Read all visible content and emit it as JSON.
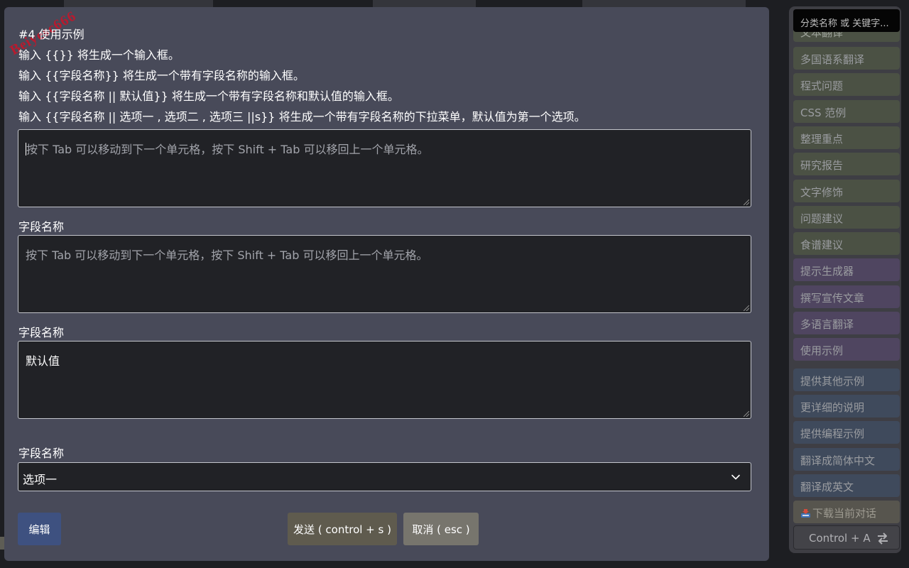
{
  "modal": {
    "watermark": "Beiyesc666",
    "instructions": [
      "#4 使用示例",
      "输入 {{}} 将生成一个输入框。",
      "输入 {{字段名称}} 将生成一个带有字段名称的输入框。",
      "输入 {{字段名称 || 默认值}} 将生成一个带有字段名称和默认值的输入框。",
      "输入 {{字段名称 || 选项一 , 选项二 , 选项三 ||s}} 将生成一个带有字段名称的下拉菜单，默认值为第一个选项。"
    ],
    "fields": [
      {
        "label": "",
        "placeholder": "按下 Tab 可以移动到下一个单元格，按下 Shift + Tab 可以移回上一个单元格。",
        "value": ""
      },
      {
        "label": "字段名称",
        "placeholder": "按下 Tab 可以移动到下一个单元格，按下 Shift + Tab 可以移回上一个单元格。",
        "value": ""
      },
      {
        "label": "字段名称",
        "placeholder": "",
        "value": "默认值"
      }
    ],
    "select": {
      "label": "字段名称",
      "selected": "选项一"
    },
    "buttons": {
      "edit": "编辑",
      "send": "发送 ( control + s )",
      "cancel": "取消 ( esc )"
    }
  },
  "sidebar": {
    "search_placeholder": "分类名称 或 关键字...",
    "partial_item": "文本翻译",
    "items": [
      {
        "label": "多国语系翻译",
        "group": "green"
      },
      {
        "label": "程式问题",
        "group": "green"
      },
      {
        "label": "CSS 范例",
        "group": "green"
      },
      {
        "label": "整理重点",
        "group": "green"
      },
      {
        "label": "研究报告",
        "group": "green"
      },
      {
        "label": "文字修饰",
        "group": "green"
      },
      {
        "label": "问题建议",
        "group": "green"
      },
      {
        "label": "食谱建议",
        "group": "green"
      },
      {
        "label": "提示生成器",
        "group": "purple"
      },
      {
        "label": "撰写宣传文章",
        "group": "purple"
      },
      {
        "label": "多语言翻译",
        "group": "purple"
      },
      {
        "label": "使用示例",
        "group": "purple"
      },
      {
        "label": "提供其他示例",
        "group": "blue"
      },
      {
        "label": "更详细的说明",
        "group": "blue"
      },
      {
        "label": "提供编程示例",
        "group": "blue"
      },
      {
        "label": "翻译成简体中文",
        "group": "blue"
      },
      {
        "label": "翻译成英文",
        "group": "blue"
      }
    ],
    "download": "下载当前对话",
    "shortcut": "Control + A"
  },
  "colors": {
    "modal_bg": "#484a59",
    "edit_button": "#3e5180",
    "send_button": "#5f5b4e",
    "cancel_button": "#77756d",
    "green_group": "#4b5144",
    "purple_group": "#4f4560",
    "blue_group": "#3f4a5c"
  },
  "icons": {
    "select_chevron": "chevron-down-icon",
    "download": "download-tray-icon",
    "shortcut": "swap-arrows-icon"
  }
}
